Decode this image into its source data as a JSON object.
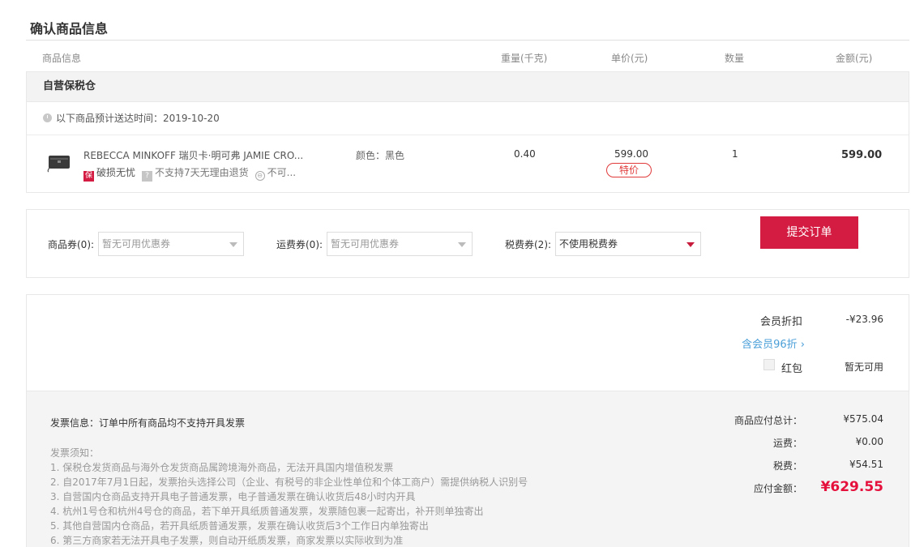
{
  "page_title": "确认商品信息",
  "columns": {
    "info": "商品信息",
    "weight": "重量(千克)",
    "unit_price": "单价(元)",
    "quantity": "数量",
    "amount": "金额(元)"
  },
  "warehouse": {
    "name": "自营保税仓",
    "delivery_text": "以下商品预计送达时间：2019-10-20",
    "item": {
      "name": "REBECCA MINKOFF 瑞贝卡·明可弗 JAMIE CRO...",
      "tag_bao_icon": "保",
      "tag_damage": "破损无忧",
      "tag_q_icon": "?",
      "tag_return": "不支持7天无理由退货",
      "tag_circle_icon": "⊖",
      "tag_more": "不可...",
      "color": "颜色：黑色",
      "weight": "0.40",
      "unit_price": "599.00",
      "special": "特价",
      "quantity": "1",
      "amount": "599.00"
    }
  },
  "coupons": {
    "goods": {
      "label": "商品券(0):",
      "value": "暂无可用优惠券"
    },
    "shipping": {
      "label": "运费券(0):",
      "value": "暂无可用优惠券"
    },
    "tax": {
      "label": "税费券(2):",
      "value": "不使用税费券"
    }
  },
  "discounts": {
    "member_label": "会员折扣",
    "member_value": "-¥23.96",
    "vip_link": "含会员96折 ›",
    "redpacket_label": "红包",
    "redpacket_value": "暂无可用"
  },
  "invoice": {
    "info": "发票信息：订单中所有商品均不支持开具发票",
    "notes_title": "发票须知：",
    "notes": [
      "1. 保税仓发货商品与海外仓发货商品属跨境海外商品，无法开具国内增值税发票",
      "2. 自2017年7月1日起，发票抬头选择公司（企业、有税号的非企业性单位和个体工商户）需提供纳税人识别号",
      "3. 自营国内仓商品支持开具电子普通发票，电子普通发票在确认收货后48小时内开具",
      "4. 杭州1号仓和杭州4号仓的商品，若下单开具纸质普通发票，发票随包裹一起寄出，补开则单独寄出",
      "5. 其他自营国内仓商品，若开具纸质普通发票，发票在确认收货后3个工作日内单独寄出",
      "6. 第三方商家若无法开具电子发票，则自动开纸质发票，商家发票以实际收到为准"
    ]
  },
  "totals": {
    "goods_label": "商品应付总计：",
    "goods_value": "¥575.04",
    "shipping_label": "运费：",
    "shipping_value": "¥0.00",
    "tax_label": "税费：",
    "tax_value": "¥54.51",
    "payable_label": "应付金额：",
    "payable_value": "¥629.55"
  },
  "submit_label": "提交订单",
  "colors": {
    "accent": "#d41c42",
    "price_red": "#e5113c",
    "link_blue": "#4a9fd8"
  }
}
